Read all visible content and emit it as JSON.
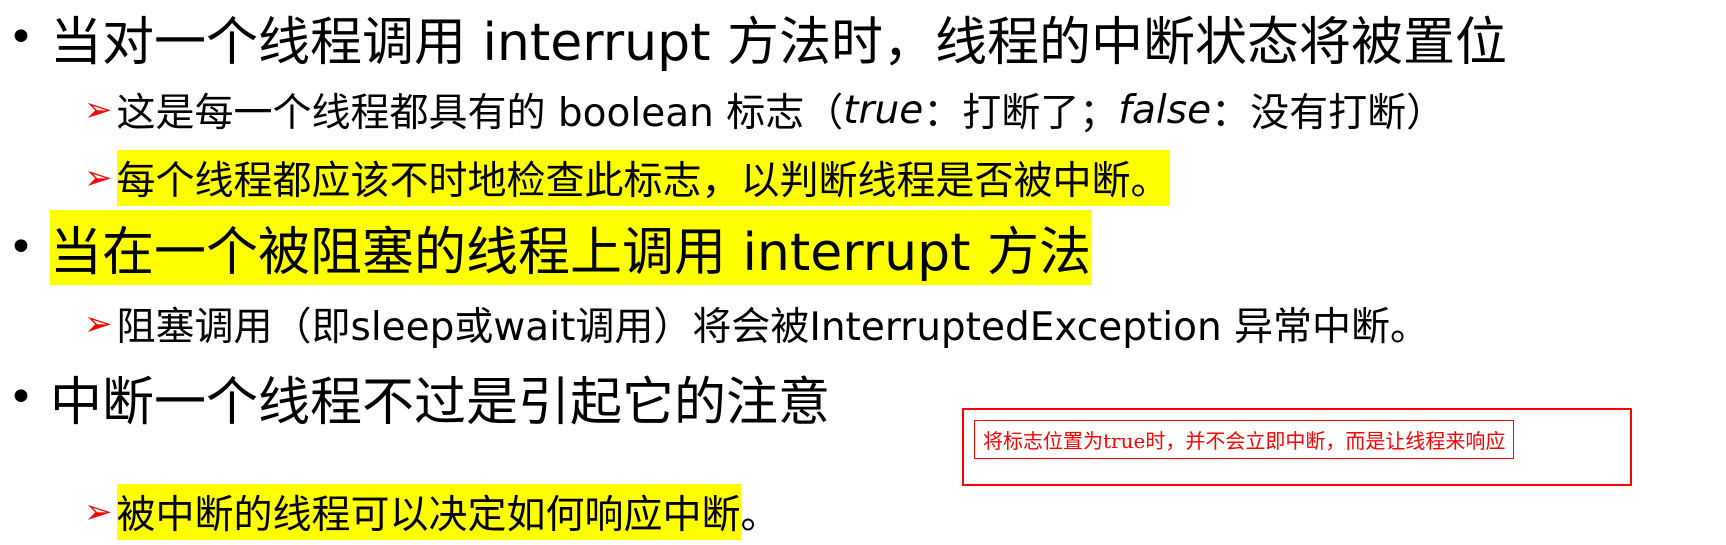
{
  "bullets": {
    "dot": "•",
    "arrow": "➢"
  },
  "items": [
    {
      "text": "当对一个线程调用 interrupt 方法时，线程的中断状态将被置位",
      "subs": [
        {
          "prefix": "这是每一个线程都具有的 boolean 标志（",
          "true_word": "true",
          "middle": "：打断了；",
          "false_word": "false",
          "suffix": "：没有打断）"
        },
        {
          "text": "每个线程都应该不时地检查此标志，以判断线程是否被中断。"
        }
      ]
    },
    {
      "text": "当在一个被阻塞的线程上调用 interrupt 方法",
      "subs": [
        {
          "text": "阻塞调用（即sleep或wait调用）将会被InterruptedException 异常中断。"
        }
      ]
    },
    {
      "text": "中断一个线程不过是引起它的注意",
      "subs": [
        {
          "text": "被中断的线程可以决定如何响应中断",
          "end": "。"
        }
      ]
    }
  ],
  "annotation": {
    "text": "将标志位置为true时，并不会立即中断，而是让线程来响应"
  },
  "colors": {
    "highlight": "#ffff00",
    "arrow": "#ff0000",
    "annotation": "#ff0000"
  }
}
